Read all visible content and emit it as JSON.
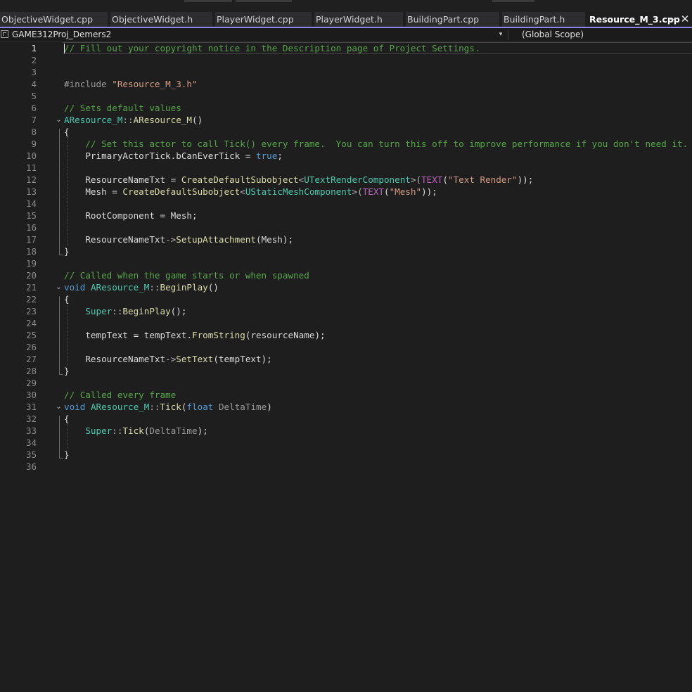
{
  "tabs": [
    {
      "label": "ObjectiveWidget.cpp",
      "active": false
    },
    {
      "label": "ObjectiveWidget.h",
      "active": false
    },
    {
      "label": "PlayerWidget.cpp",
      "active": false
    },
    {
      "label": "PlayerWidget.h",
      "active": false
    },
    {
      "label": "BuildingPart.cpp",
      "active": false
    },
    {
      "label": "BuildingPart.h",
      "active": false
    },
    {
      "label": "Resource_M_3.cpp",
      "active": true
    }
  ],
  "tab_pin_glyph": "⊸",
  "tab_close_glyph": "✕",
  "navbar": {
    "project": "GAME312Proj_Demers2",
    "dropdown_glyph": "▾",
    "scope": "(Global Scope)"
  },
  "editor": {
    "current_line": 1,
    "fold_glyph": "⌄",
    "lines": [
      {
        "n": "1",
        "tokens": [
          {
            "t": "// Fill out your copyright notice in the Description page of Project Settings.",
            "c": "comment"
          }
        ]
      },
      {
        "n": "2",
        "tokens": []
      },
      {
        "n": "3",
        "tokens": []
      },
      {
        "n": "4",
        "tokens": [
          {
            "t": "#include ",
            "c": "pre"
          },
          {
            "t": "\"Resource_M_3.h\"",
            "c": "str"
          }
        ]
      },
      {
        "n": "5",
        "tokens": []
      },
      {
        "n": "6",
        "tokens": [
          {
            "t": "// Sets default values",
            "c": "comment"
          }
        ]
      },
      {
        "n": "7",
        "fold": true,
        "tokens": [
          {
            "t": "AResource_M",
            "c": "type"
          },
          {
            "t": "::",
            "c": "op"
          },
          {
            "t": "AResource_M",
            "c": "func"
          },
          {
            "t": "()",
            "c": "plain"
          }
        ]
      },
      {
        "n": "8",
        "tokens": [
          {
            "t": "{",
            "c": "plain"
          }
        ]
      },
      {
        "n": "9",
        "tokens": [
          {
            "t": "    // Set this actor to call Tick() every frame.  You can turn this off to improve performance if you don't need it.",
            "c": "comment"
          }
        ]
      },
      {
        "n": "10",
        "tokens": [
          {
            "t": "    PrimaryActorTick",
            "c": "var"
          },
          {
            "t": ".",
            "c": "plain"
          },
          {
            "t": "bCanEverTick",
            "c": "var"
          },
          {
            "t": " = ",
            "c": "plain"
          },
          {
            "t": "true",
            "c": "kw"
          },
          {
            "t": ";",
            "c": "plain"
          }
        ]
      },
      {
        "n": "11",
        "tokens": []
      },
      {
        "n": "12",
        "tokens": [
          {
            "t": "    ResourceNameTxt",
            "c": "var"
          },
          {
            "t": " = ",
            "c": "plain"
          },
          {
            "t": "CreateDefaultSubobject",
            "c": "func"
          },
          {
            "t": "<",
            "c": "op"
          },
          {
            "t": "UTextRenderComponent",
            "c": "type"
          },
          {
            "t": ">(",
            "c": "op"
          },
          {
            "t": "TEXT",
            "c": "macro"
          },
          {
            "t": "(",
            "c": "plain"
          },
          {
            "t": "\"Text Render\"",
            "c": "str"
          },
          {
            "t": "));",
            "c": "plain"
          }
        ]
      },
      {
        "n": "13",
        "tokens": [
          {
            "t": "    Mesh",
            "c": "var"
          },
          {
            "t": " = ",
            "c": "plain"
          },
          {
            "t": "CreateDefaultSubobject",
            "c": "func"
          },
          {
            "t": "<",
            "c": "op"
          },
          {
            "t": "UStaticMeshComponent",
            "c": "type"
          },
          {
            "t": ">(",
            "c": "op"
          },
          {
            "t": "TEXT",
            "c": "macro"
          },
          {
            "t": "(",
            "c": "plain"
          },
          {
            "t": "\"Mesh\"",
            "c": "str"
          },
          {
            "t": "));",
            "c": "plain"
          }
        ]
      },
      {
        "n": "14",
        "tokens": []
      },
      {
        "n": "15",
        "tokens": [
          {
            "t": "    RootComponent",
            "c": "var"
          },
          {
            "t": " = ",
            "c": "plain"
          },
          {
            "t": "Mesh",
            "c": "var"
          },
          {
            "t": ";",
            "c": "plain"
          }
        ]
      },
      {
        "n": "16",
        "tokens": []
      },
      {
        "n": "17",
        "tokens": [
          {
            "t": "    ResourceNameTxt",
            "c": "var"
          },
          {
            "t": "->",
            "c": "op"
          },
          {
            "t": "SetupAttachment",
            "c": "func"
          },
          {
            "t": "(",
            "c": "plain"
          },
          {
            "t": "Mesh",
            "c": "var"
          },
          {
            "t": ");",
            "c": "plain"
          }
        ]
      },
      {
        "n": "18",
        "tokens": [
          {
            "t": "}",
            "c": "plain"
          }
        ]
      },
      {
        "n": "19",
        "tokens": []
      },
      {
        "n": "20",
        "tokens": [
          {
            "t": "// Called when the game starts or when spawned",
            "c": "comment"
          }
        ]
      },
      {
        "n": "21",
        "fold": true,
        "tokens": [
          {
            "t": "void",
            "c": "kw"
          },
          {
            "t": " ",
            "c": "plain"
          },
          {
            "t": "AResource_M",
            "c": "type"
          },
          {
            "t": "::",
            "c": "op"
          },
          {
            "t": "BeginPlay",
            "c": "func"
          },
          {
            "t": "()",
            "c": "plain"
          }
        ]
      },
      {
        "n": "22",
        "tokens": [
          {
            "t": "{",
            "c": "plain"
          }
        ]
      },
      {
        "n": "23",
        "tokens": [
          {
            "t": "    Super",
            "c": "type"
          },
          {
            "t": "::",
            "c": "op"
          },
          {
            "t": "BeginPlay",
            "c": "func"
          },
          {
            "t": "();",
            "c": "plain"
          }
        ]
      },
      {
        "n": "24",
        "tokens": []
      },
      {
        "n": "25",
        "tokens": [
          {
            "t": "    tempText",
            "c": "var"
          },
          {
            "t": " = ",
            "c": "plain"
          },
          {
            "t": "tempText",
            "c": "var"
          },
          {
            "t": ".",
            "c": "plain"
          },
          {
            "t": "FromString",
            "c": "func"
          },
          {
            "t": "(",
            "c": "plain"
          },
          {
            "t": "resourceName",
            "c": "var"
          },
          {
            "t": ");",
            "c": "plain"
          }
        ]
      },
      {
        "n": "26",
        "tokens": []
      },
      {
        "n": "27",
        "tokens": [
          {
            "t": "    ResourceNameTxt",
            "c": "var"
          },
          {
            "t": "->",
            "c": "op"
          },
          {
            "t": "SetText",
            "c": "func"
          },
          {
            "t": "(",
            "c": "plain"
          },
          {
            "t": "tempText",
            "c": "var"
          },
          {
            "t": ");",
            "c": "plain"
          }
        ]
      },
      {
        "n": "28",
        "tokens": [
          {
            "t": "}",
            "c": "plain"
          }
        ]
      },
      {
        "n": "29",
        "tokens": []
      },
      {
        "n": "30",
        "tokens": [
          {
            "t": "// Called every frame",
            "c": "comment"
          }
        ]
      },
      {
        "n": "31",
        "fold": true,
        "tokens": [
          {
            "t": "void",
            "c": "kw"
          },
          {
            "t": " ",
            "c": "plain"
          },
          {
            "t": "AResource_M",
            "c": "type"
          },
          {
            "t": "::",
            "c": "op"
          },
          {
            "t": "Tick",
            "c": "func"
          },
          {
            "t": "(",
            "c": "plain"
          },
          {
            "t": "float",
            "c": "kw"
          },
          {
            "t": " ",
            "c": "plain"
          },
          {
            "t": "DeltaTime",
            "c": "param"
          },
          {
            "t": ")",
            "c": "plain"
          }
        ]
      },
      {
        "n": "32",
        "tokens": [
          {
            "t": "{",
            "c": "plain"
          }
        ]
      },
      {
        "n": "33",
        "tokens": [
          {
            "t": "    Super",
            "c": "type"
          },
          {
            "t": "::",
            "c": "op"
          },
          {
            "t": "Tick",
            "c": "func"
          },
          {
            "t": "(",
            "c": "plain"
          },
          {
            "t": "DeltaTime",
            "c": "param"
          },
          {
            "t": ");",
            "c": "plain"
          }
        ]
      },
      {
        "n": "34",
        "tokens": []
      },
      {
        "n": "35",
        "tokens": [
          {
            "t": "}",
            "c": "plain"
          }
        ]
      },
      {
        "n": "36",
        "tokens": []
      }
    ]
  }
}
